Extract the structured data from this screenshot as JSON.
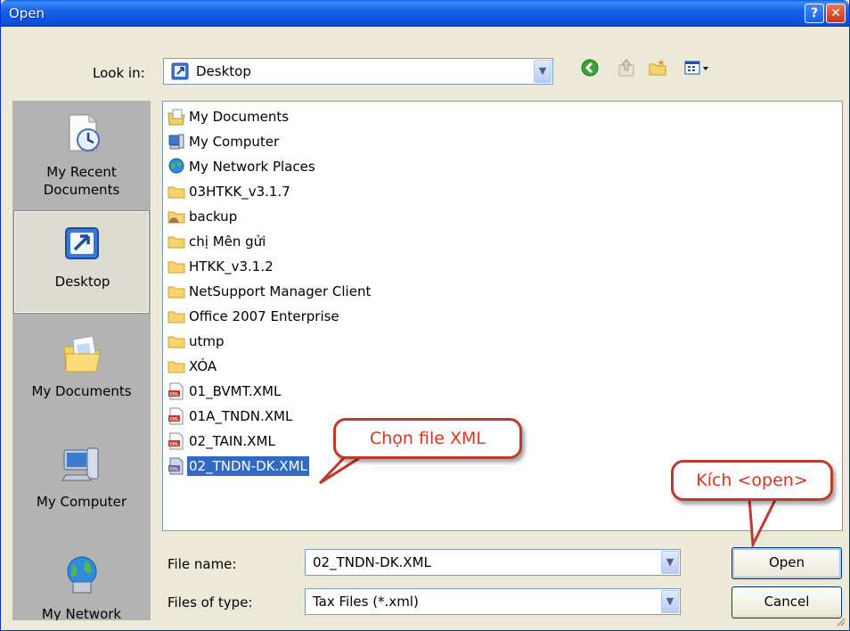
{
  "window": {
    "title": "Open"
  },
  "titlebar": {
    "help_label": "?",
    "close_label": "✕"
  },
  "toolbar": {
    "look_in_label": "Look in:",
    "look_in_value": "Desktop",
    "icons": [
      "back-icon",
      "up-folder-icon",
      "new-folder-icon",
      "views-menu-icon"
    ]
  },
  "places": [
    {
      "label": "My Recent Documents",
      "icon": "recent-documents-icon",
      "selected": false
    },
    {
      "label": "Desktop",
      "icon": "desktop-icon",
      "selected": true
    },
    {
      "label": "My Documents",
      "icon": "my-documents-icon",
      "selected": false
    },
    {
      "label": "My Computer",
      "icon": "my-computer-icon",
      "selected": false
    },
    {
      "label": "My Network",
      "icon": "my-network-icon",
      "selected": false
    }
  ],
  "files": [
    {
      "name": "My Documents",
      "icon": "my-documents-icon"
    },
    {
      "name": "My Computer",
      "icon": "computer-icon"
    },
    {
      "name": "My Network Places",
      "icon": "network-places-icon"
    },
    {
      "name": "03HTKK_v3.1.7",
      "icon": "folder-icon"
    },
    {
      "name": "backup",
      "icon": "shared-folder-icon"
    },
    {
      "name": "chị Mên gửi",
      "icon": "folder-icon"
    },
    {
      "name": "HTKK_v3.1.2",
      "icon": "folder-icon"
    },
    {
      "name": "NetSupport Manager Client",
      "icon": "folder-icon"
    },
    {
      "name": "Office 2007 Enterprise",
      "icon": "folder-icon"
    },
    {
      "name": "utmp",
      "icon": "folder-icon"
    },
    {
      "name": "XÓA",
      "icon": "folder-icon"
    },
    {
      "name": "01_BVMT.XML",
      "icon": "xml-file-icon"
    },
    {
      "name": "01A_TNDN.XML",
      "icon": "xml-file-icon"
    },
    {
      "name": "02_TAIN.XML",
      "icon": "xml-file-icon"
    },
    {
      "name": "02_TNDN-DK.XML",
      "icon": "xml-file-icon",
      "selected": true
    }
  ],
  "bottom": {
    "file_name_label": "File name:",
    "file_name_value": "02_TNDN-DK.XML",
    "file_type_label": "Files of type:",
    "file_type_value": "Tax Files (*.xml)",
    "open_label": "Open",
    "cancel_label": "Cancel"
  },
  "annotations": {
    "choose_file": "Chọn file XML",
    "click_open": "Kích <open>"
  },
  "colors": {
    "titlebar": "#0a5fef",
    "selection": "#316ac5",
    "callout_border": "#c0392b",
    "callout_text": "#e0301e",
    "dialog_bg": "#ece9d8"
  }
}
